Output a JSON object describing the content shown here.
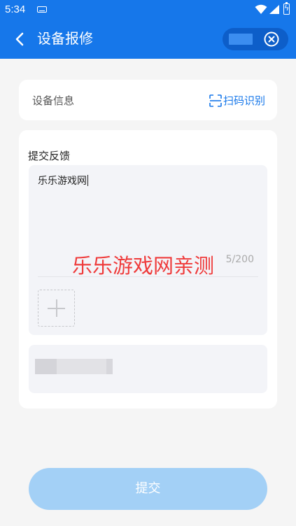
{
  "status_bar": {
    "time": "5:34",
    "icons": [
      "keyboard-icon",
      "wifi-icon",
      "signal-icon",
      "battery-charging-icon"
    ]
  },
  "app_bar": {
    "title": "设备报修",
    "back_icon": "chevron-left-icon",
    "close_icon": "close-circle-icon"
  },
  "device_info": {
    "label": "设备信息",
    "scan_label": "扫码识别",
    "scan_icon": "scan-icon"
  },
  "feedback": {
    "title": "提交反馈",
    "input_value": "乐乐游戏网",
    "char_count": "5/200",
    "add_image_icon": "plus-icon"
  },
  "watermark": "乐乐游戏网亲测",
  "submit_label": "提交",
  "colors": {
    "primary": "#1677ea",
    "submit_disabled": "#a3d0f6",
    "watermark": "#ef3b3b",
    "background": "#f5f5f5"
  }
}
